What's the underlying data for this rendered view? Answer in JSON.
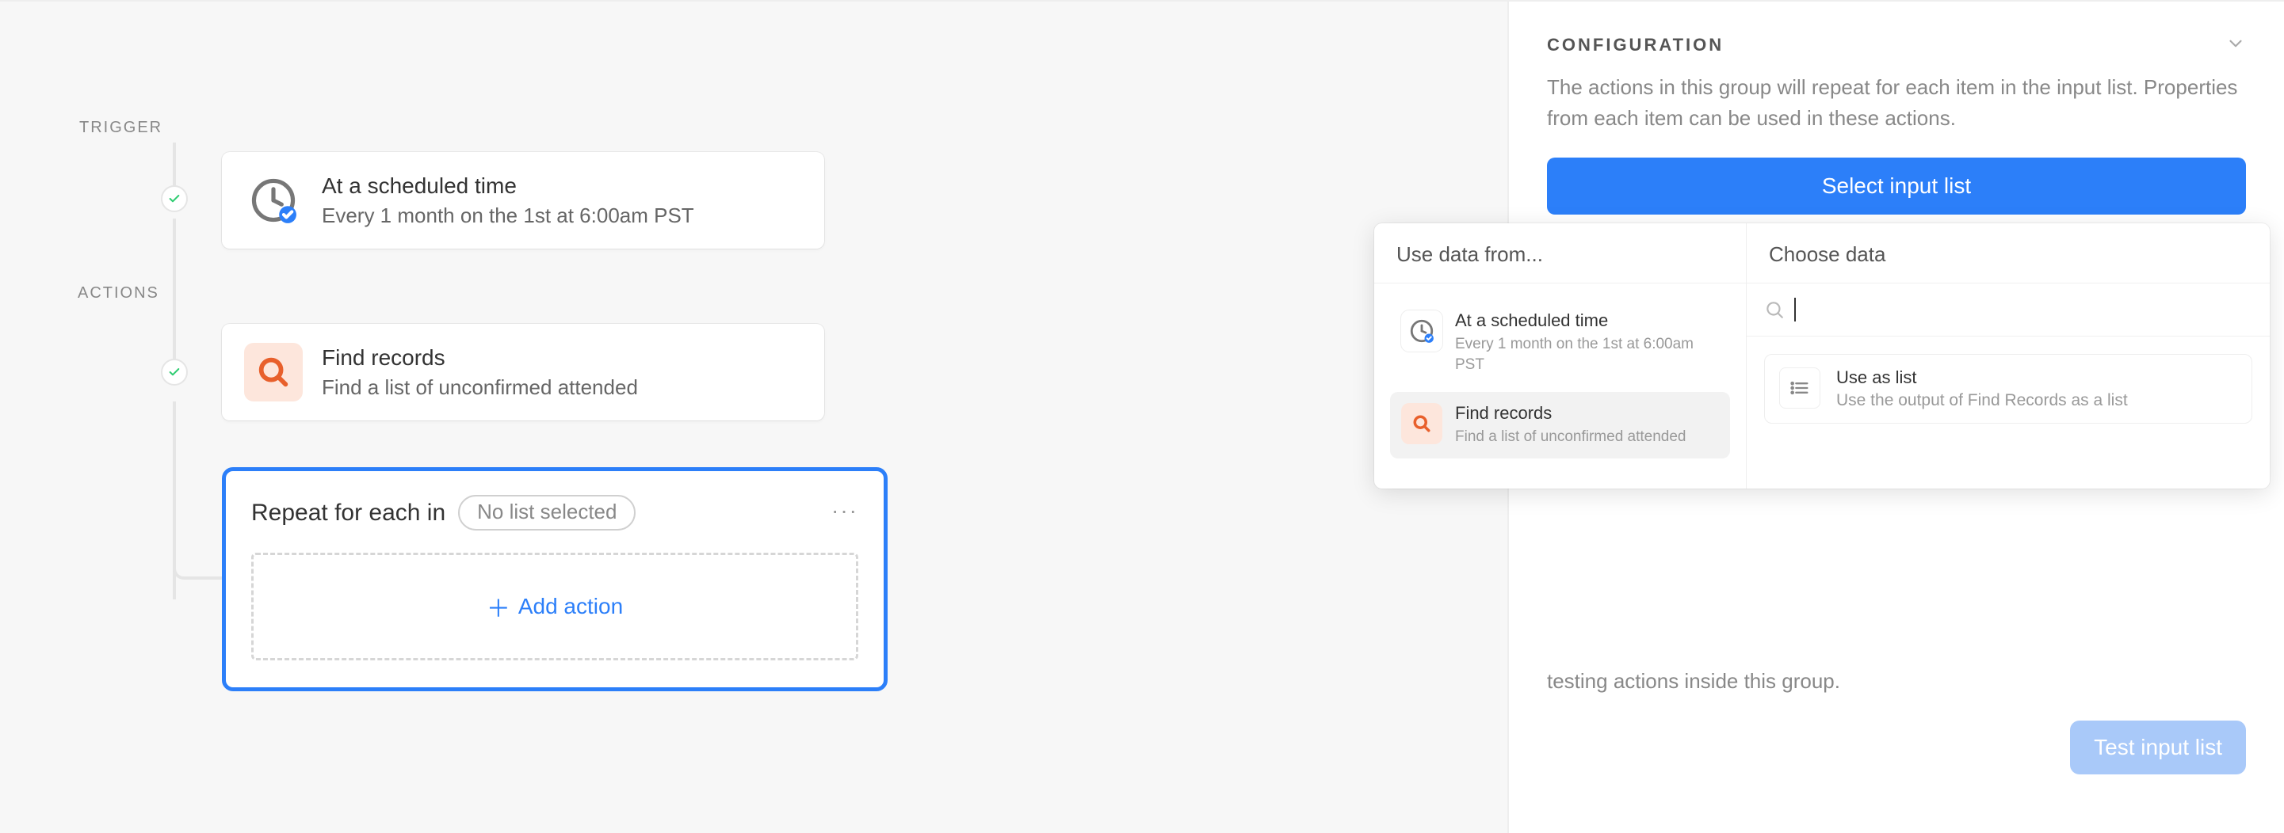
{
  "labels": {
    "trigger": "TRIGGER",
    "actions": "ACTIONS"
  },
  "nodes": {
    "trigger": {
      "title": "At a scheduled time",
      "subtitle": "Every 1 month on the 1st at 6:00am PST"
    },
    "find": {
      "title": "Find records",
      "subtitle": "Find a list of unconfirmed attended"
    }
  },
  "repeat": {
    "title": "Repeat for each in",
    "pill": "No list selected",
    "add_action": "Add action"
  },
  "config": {
    "heading": "CONFIGURATION",
    "description": "The actions in this group will repeat for each item in the input list. Properties from each item can be used in these actions.",
    "select_btn": "Select input list",
    "test_desc_tail": "testing actions inside this group.",
    "test_btn": "Test input list"
  },
  "popover": {
    "left_head": "Use data from...",
    "right_head": "Choose data",
    "sources": [
      {
        "title": "At a scheduled time",
        "subtitle": "Every 1 month on the 1st at 6:00am PST"
      },
      {
        "title": "Find records",
        "subtitle": "Find a list of unconfirmed attended"
      }
    ],
    "choose": {
      "title": "Use as list",
      "subtitle": "Use the output of Find Records as a list"
    },
    "search_placeholder": ""
  }
}
